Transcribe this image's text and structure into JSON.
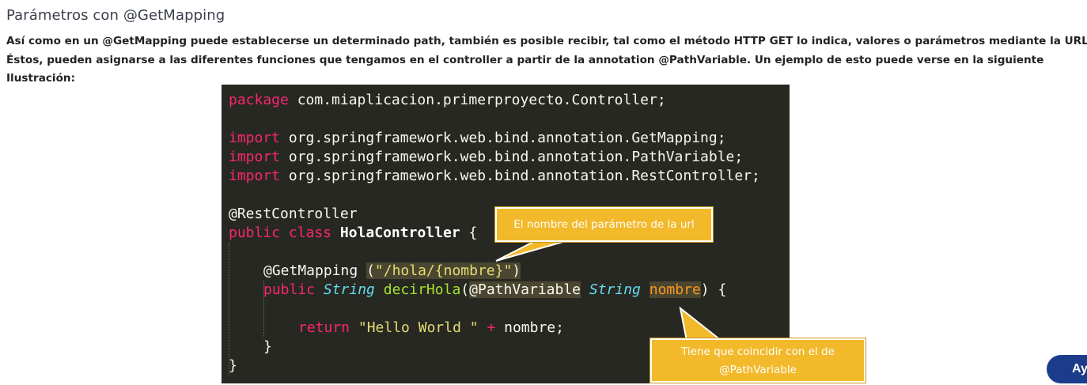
{
  "article": {
    "heading": "Parámetros con @GetMapping",
    "paragraph_lines": [
      "Así como en un @GetMapping puede establecerse un determinado path, también es posible recibir, tal como el método HTTP GET lo indica, valores o parámetros mediante la URL.",
      "Éstos, pueden asignarse a las diferentes funciones que tengamos en el controller a partir de la annotation @PathVariable. Un ejemplo de esto puede verse en la siguiente",
      "Ilustración:"
    ]
  },
  "code": {
    "l1_kw": "package",
    "l1_rest": " com.miaplicacion.primerproyecto.Controller;",
    "imports": [
      {
        "kw": "import",
        "rest": " org.springframework.web.bind.annotation.GetMapping;"
      },
      {
        "kw": "import",
        "rest": " org.springframework.web.bind.annotation.PathVariable;"
      },
      {
        "kw": "import",
        "rest": " org.springframework.web.bind.annotation.RestController;"
      }
    ],
    "annotation_rest": "@RestController",
    "class_kw1": "public",
    "class_kw2": "class",
    "class_name": "HolaController",
    "class_open": " {",
    "getmapping": "@GetMapping",
    "getmapping_arg_open": "(",
    "getmapping_arg_str": "\"/hola/{nombre}\"",
    "getmapping_arg_close": ")",
    "method_kw": "public",
    "method_type": "String",
    "method_name": "decirHola",
    "method_paren": "(",
    "pathvariable": "@PathVariable",
    "param_type": "String",
    "param_name": "nombre",
    "method_close": ") {",
    "return_kw": "return",
    "return_str": "\"Hello World \"",
    "return_op": "+",
    "return_var": " nombre;",
    "brace_inner": "}",
    "brace_outer": "}"
  },
  "callouts": {
    "top": "El nombre del parámetro de la url",
    "bottom_line1": "Tiene que coincidir con el de",
    "bottom_line2": "@PathVariable"
  },
  "help_button": {
    "label": "Ay"
  }
}
